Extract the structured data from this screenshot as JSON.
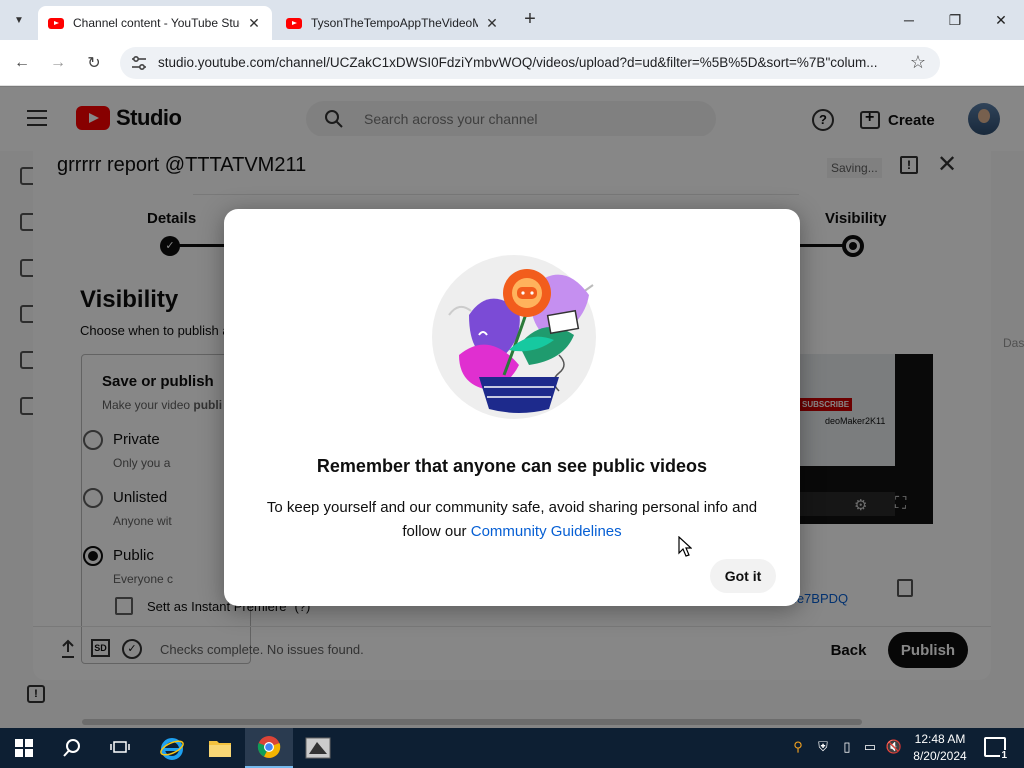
{
  "browser": {
    "tabs": [
      {
        "title": "Channel content - YouTube Studio",
        "active": true
      },
      {
        "title": "TysonTheTempoAppTheVideoMaker",
        "active": false
      }
    ],
    "url": "studio.youtube.com/channel/UCZakC1xDWSI0FdziYmbvWOQ/videos/upload?d=ud&filter=%5B%5D&sort=%7B\"colum...",
    "profile_initial": "C"
  },
  "studio": {
    "logo_text": "Studio",
    "search_placeholder": "Search across your channel",
    "create_label": "Create"
  },
  "upload": {
    "title": "grrrrr report @TTTATVM211",
    "status": "Saving...",
    "steps": {
      "first": "Details",
      "last": "Visibility"
    },
    "visibility_heading": "Visibility",
    "visibility_sub": "Choose when to publish a",
    "save_or_publish": {
      "title": "Save or publish",
      "sub_prefix": "Make your video ",
      "sub_bold": "publi"
    },
    "options": [
      {
        "label": "Private",
        "sub": "Only you a",
        "selected": false
      },
      {
        "label": "Unlisted",
        "sub": "Anyone wit",
        "selected": false
      },
      {
        "label": "Public",
        "sub": "Everyone c",
        "selected": true
      }
    ],
    "premiere_label": "Sett as Instant Premiere",
    "premiere_hint": "(?)",
    "preview_subscribe": "SUBSCRIBE",
    "preview_channel": "deoMaker2K11",
    "video_link_fragment": "Me7BPDQ",
    "checks_text": "Checks complete. No issues found.",
    "back_label": "Back",
    "publish_label": "Publish",
    "side_fragment": "Das"
  },
  "modal": {
    "title": "Remember that anyone can see public videos",
    "body_text": "To keep yourself and our community safe, avoid sharing personal info and follow our ",
    "link_text": "Community Guidelines",
    "button_label": "Got it"
  },
  "taskbar": {
    "time": "12:48 AM",
    "date": "8/20/2024",
    "notification_count": "1"
  },
  "colors": {
    "youtube_red": "#ff0000",
    "link_blue": "#065fd4",
    "taskbar": "#0d1f33"
  }
}
